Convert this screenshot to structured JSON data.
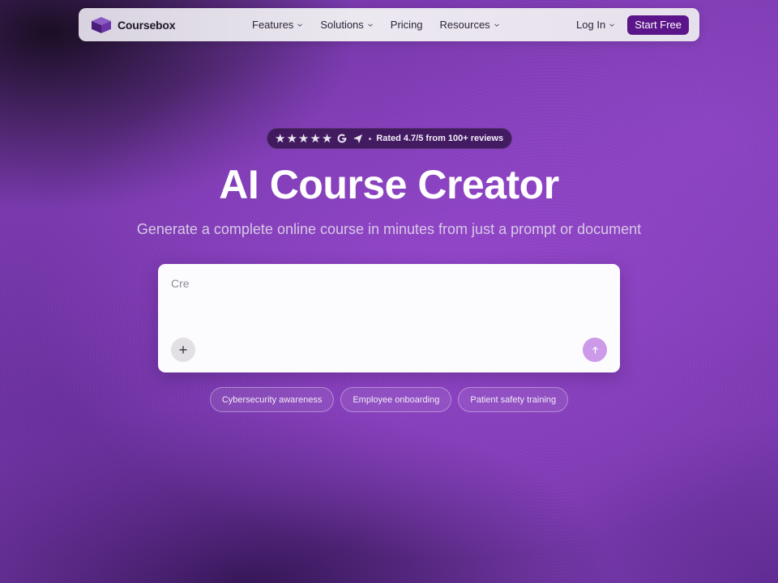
{
  "brand": {
    "name": "Coursebox",
    "logo_icon": "cube-icon"
  },
  "nav": {
    "items": [
      {
        "label": "Features",
        "has_dropdown": true
      },
      {
        "label": "Solutions",
        "has_dropdown": true
      },
      {
        "label": "Pricing",
        "has_dropdown": false
      },
      {
        "label": "Resources",
        "has_dropdown": true
      }
    ],
    "login_label": "Log In",
    "cta_label": "Start Free"
  },
  "rating": {
    "stars": 5,
    "text": "Rated 4.7/5 from 100+ reviews",
    "icons": [
      "star-icon",
      "google-icon",
      "capterra-arrow-icon"
    ]
  },
  "hero": {
    "title": "AI Course Creator",
    "subtitle": "Generate a complete online course in minutes from just a prompt or document"
  },
  "prompt": {
    "placeholder": "Cre",
    "add_icon": "plus-icon",
    "send_icon": "arrow-up-icon"
  },
  "suggestions": [
    "Cybersecurity awareness",
    "Employee onboarding",
    "Patient safety training"
  ],
  "colors": {
    "accent": "#5b1489",
    "send_button": "#cc9ae8",
    "background": "#7a3aae"
  }
}
